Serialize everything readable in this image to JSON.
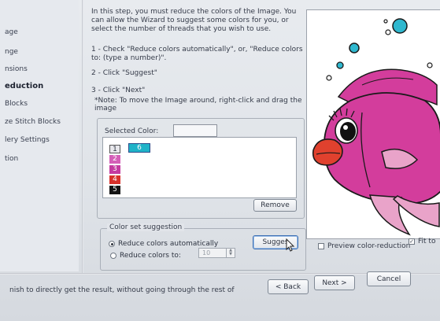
{
  "sidebar": {
    "items": [
      {
        "label": "age",
        "active": false
      },
      {
        "label": "nge",
        "active": false
      },
      {
        "label": "nsions",
        "active": false
      },
      {
        "label": "eduction",
        "active": true
      },
      {
        "label": "Blocks",
        "active": false
      },
      {
        "label": "ze Stitch Blocks",
        "active": false
      },
      {
        "label": "lery Settings",
        "active": false
      },
      {
        "label": "tion",
        "active": false
      }
    ]
  },
  "instructions": {
    "intro": "In this step, you must reduce the colors of the Image. You can allow the Wizard to suggest some colors for you, or select the number of threads that you wish to use.",
    "step1": "1 -  Check \"Reduce colors automatically\", or, \"Reduce colors to: (type a number)\".",
    "step2": "2 -  Click \"Suggest\"",
    "step3": "3 -  Click \"Next\"",
    "note": "*Note: To move the Image around, right-click and drag the image"
  },
  "selected_color": {
    "label": "Selected Color:"
  },
  "color_list": {
    "chips": [
      {
        "index": "1",
        "color": "#e8e8ec",
        "text_color": "#2d3340"
      },
      {
        "index": "2",
        "color": "#d45fb8",
        "text_color": "#ffffff"
      },
      {
        "index": "3",
        "color": "#c43aa0",
        "text_color": "#ffffff"
      },
      {
        "index": "4",
        "color": "#d8302a",
        "text_color": "#ffffff"
      },
      {
        "index": "5",
        "color": "#141414",
        "text_color": "#ffffff"
      },
      {
        "index": "6",
        "color": "#1fb3c8",
        "text_color": "#ffffff"
      }
    ]
  },
  "buttons": {
    "remove": "Remove",
    "suggest": "Sugges",
    "back": "< Back",
    "next": "Next >",
    "cancel": "Cancel"
  },
  "color_set": {
    "legend": "Color set suggestion",
    "auto_label": "Reduce colors automatically",
    "to_label": "Reduce colors to:",
    "to_value": "10",
    "auto_selected": true
  },
  "preview": {
    "reduction_label": "Preview color-reduction",
    "fit_label": "Fit to",
    "fit_checked": true,
    "reduction_checked": false
  },
  "status": {
    "text": "nish to directly get the result, without going through the rest of"
  },
  "colors": {
    "fish_body": "#d33d9c",
    "fish_fin": "#e9a3c9",
    "lips": "#e0412e",
    "bubble": "#2fb8cf"
  }
}
